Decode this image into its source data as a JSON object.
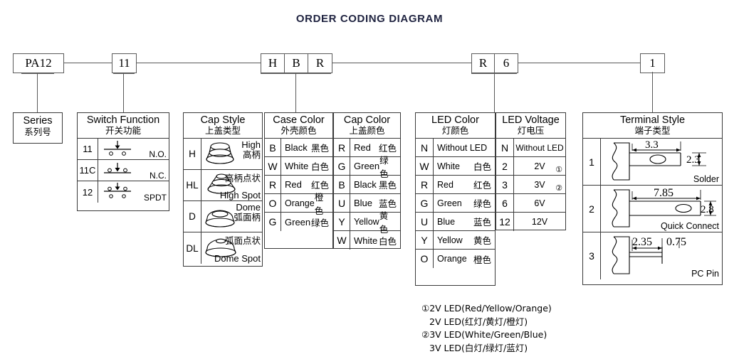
{
  "title": "ORDER CODING DIAGRAM",
  "code_row": {
    "boxes": [
      {
        "name": "series",
        "cells": [
          "PA12"
        ]
      },
      {
        "name": "switch-function",
        "cells": [
          "11"
        ]
      },
      {
        "name": "cap-case-capcolor",
        "cells": [
          "H",
          "B",
          "R"
        ]
      },
      {
        "name": "led",
        "cells": [
          "R",
          "6"
        ]
      },
      {
        "name": "terminal",
        "cells": [
          "1"
        ]
      }
    ]
  },
  "series": {
    "en": "Series",
    "cn": "系列号"
  },
  "switch_function": {
    "en": "Switch Function",
    "cn": "开关功能",
    "rows": [
      {
        "code": "11",
        "label": "N.O.",
        "symbol": "spst-no"
      },
      {
        "code": "11C",
        "label": "N.C.",
        "symbol": "spst-nc"
      },
      {
        "code": "12",
        "label": "SPDT",
        "symbol": "spdt"
      }
    ]
  },
  "cap_style": {
    "en": "Cap Style",
    "cn": "上盖类型",
    "rows": [
      {
        "code": "H",
        "en": "High",
        "cn": "高柄",
        "icon": "cap-high",
        "layout": "right"
      },
      {
        "code": "HL",
        "en": "High Spot",
        "cn": "高柄点状",
        "icon": "cap-high-spot",
        "layout": "split"
      },
      {
        "code": "D",
        "en": "Dome",
        "cn": "弧面柄",
        "icon": "cap-dome",
        "layout": "right"
      },
      {
        "code": "DL",
        "en": "Dome Spot",
        "cn": "弧面点状",
        "icon": "cap-dome-spot",
        "layout": "split"
      }
    ]
  },
  "case_color": {
    "en": "Case Color",
    "cn": "外壳颜色",
    "rows": [
      {
        "code": "B",
        "en": "Black",
        "cn": "黑色"
      },
      {
        "code": "W",
        "en": "White",
        "cn": "白色"
      },
      {
        "code": "R",
        "en": "Red",
        "cn": "红色"
      },
      {
        "code": "O",
        "en": "Orange",
        "cn": "橙色"
      },
      {
        "code": "G",
        "en": "Green",
        "cn": "绿色"
      }
    ]
  },
  "cap_color": {
    "en": "Cap Color",
    "cn": "上盖颜色",
    "rows": [
      {
        "code": "R",
        "en": "Red",
        "cn": "红色"
      },
      {
        "code": "G",
        "en": "Green",
        "cn": "绿色"
      },
      {
        "code": "B",
        "en": "Black",
        "cn": "黑色"
      },
      {
        "code": "U",
        "en": "Blue",
        "cn": "蓝色"
      },
      {
        "code": "Y",
        "en": "Yellow",
        "cn": "黄色"
      },
      {
        "code": "W",
        "en": "White",
        "cn": "白色"
      }
    ]
  },
  "led_color": {
    "en": "LED Color",
    "cn": "灯颜色",
    "rows": [
      {
        "code": "N",
        "en": "Without  LED",
        "cn": ""
      },
      {
        "code": "W",
        "en": "White",
        "cn": "白色"
      },
      {
        "code": "R",
        "en": "Red",
        "cn": "红色"
      },
      {
        "code": "G",
        "en": "Green",
        "cn": "绿色"
      },
      {
        "code": "U",
        "en": "Blue",
        "cn": "蓝色"
      },
      {
        "code": "Y",
        "en": "Yellow",
        "cn": "黄色"
      },
      {
        "code": "O",
        "en": "Orange",
        "cn": "橙色"
      }
    ]
  },
  "led_voltage": {
    "en": "LED Voltage",
    "cn": "灯电压",
    "rows": [
      {
        "code": "N",
        "value": "Without  LED",
        "mark": ""
      },
      {
        "code": "2",
        "value": "2V",
        "mark": "①"
      },
      {
        "code": "3",
        "value": "3V",
        "mark": "②"
      },
      {
        "code": "6",
        "value": "6V",
        "mark": ""
      },
      {
        "code": "12",
        "value": "12V",
        "mark": ""
      }
    ]
  },
  "terminal_style": {
    "en": "Terminal Style",
    "cn": "端子类型",
    "rows": [
      {
        "code": "1",
        "label": "Solder",
        "dim_a": "3.3",
        "dim_b": "2.3",
        "icon": "terminal-solder"
      },
      {
        "code": "2",
        "label": "Quick Connect",
        "dim_a": "7.85",
        "dim_b": "2.8",
        "icon": "terminal-quick-connect"
      },
      {
        "code": "3",
        "label": "PC Pin",
        "dim_a": "2.35",
        "dim_b": "0.75",
        "icon": "terminal-pc-pin"
      }
    ]
  },
  "notes": [
    "①2V LED(Red/Yellow/Orange)",
    "2V LED(红灯/黄灯/橙灯)",
    "②3V LED(White/Green/Blue)",
    "3V LED(白灯/绿灯/蓝灯)"
  ],
  "colors": {
    "line": "#3a3a3a",
    "thin_line": "#5a5a5a",
    "title": "#1f2340"
  }
}
